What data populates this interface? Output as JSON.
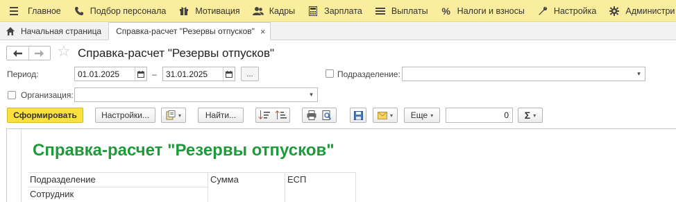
{
  "menu": {
    "items": [
      {
        "label": "Главное",
        "icon": "menu-burger-icon"
      },
      {
        "label": "Подбор персонала",
        "icon": "phone-icon"
      },
      {
        "label": "Мотивация",
        "icon": "gift-icon"
      },
      {
        "label": "Кадры",
        "icon": "people-icon"
      },
      {
        "label": "Зарплата",
        "icon": "calculator-icon"
      },
      {
        "label": "Выплаты",
        "icon": "list-icon"
      },
      {
        "label": "Налоги и взносы",
        "icon": "percent-icon"
      },
      {
        "label": "Настройка",
        "icon": "wrench-icon"
      },
      {
        "label": "Администри",
        "icon": "gear-icon"
      }
    ]
  },
  "tabs": {
    "home": "Начальная страница",
    "active": "Справка-расчет \"Резервы отпусков\"",
    "close": "×"
  },
  "form": {
    "title": "Справка-расчет \"Резервы отпусков\"",
    "period_label": "Период:",
    "date_from": "01.01.2025",
    "date_sep": "–",
    "date_to": "31.01.2025",
    "dots": "...",
    "subdivision_label": "Подразделение:",
    "subdivision_value": "",
    "organization_label": "Организация:",
    "organization_value": ""
  },
  "toolbar": {
    "generate": "Сформировать",
    "settings": "Настройки...",
    "find": "Найти...",
    "more": "Еще",
    "number_value": "0",
    "sum_symbol": "Σ"
  },
  "report": {
    "title": "Справка-расчет \"Резервы отпусков\"",
    "columns": [
      "Подразделение",
      "Сумма",
      "ЕСП"
    ],
    "subheader": "Сотрудник"
  }
}
